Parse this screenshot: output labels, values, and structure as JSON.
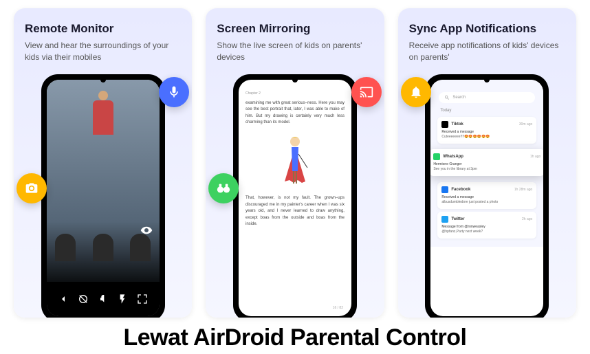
{
  "cards": [
    {
      "title": "Remote Monitor",
      "desc": "View and hear the surroundings of your kids via their mobiles"
    },
    {
      "title": "Screen Mirroring",
      "desc": "Show the live screen of kids on parents' devices"
    },
    {
      "title": "Sync App Notifications",
      "desc": "Receive app notifications of kids' devices on parents'"
    }
  ],
  "reader": {
    "chapter": "Chapter 2",
    "para1": "examining me with great serious–ness. Here you may see the best portrait that, later, I was able to make of him. But my drawing is certainly very much less charming than its model.",
    "para2": "That, however, is not my fault. The grown–ups discouraged me in my painter's career when I was six years old, and I never learned to draw anything, except boas from the outside and boas from the inside.",
    "page": "16 / 82"
  },
  "notifications": {
    "search": "Search",
    "today": "Today",
    "items": [
      {
        "app": "Tiktok",
        "time": "30m ago",
        "title": "Received a message",
        "body": "Cuteeeeeee!!!!😍😍😍😍😍😍",
        "color": "#000"
      },
      {
        "app": "WhatsApp",
        "time": "1h ago",
        "title": "Hermione Granger",
        "body": "See you in the library at 3pm",
        "color": "#25d366"
      },
      {
        "app": "Facebook",
        "time": "1h 28m ago",
        "title": "Received a message",
        "body": "albusdumbledore just posted a photo",
        "color": "#1877f2"
      },
      {
        "app": "Twitter",
        "time": "2h ago",
        "title": "Message from @ronweasley",
        "body": "@hpfanz,Party next week?",
        "color": "#1da1f2"
      }
    ]
  },
  "footer": "Lewat AirDroid Parental Control"
}
